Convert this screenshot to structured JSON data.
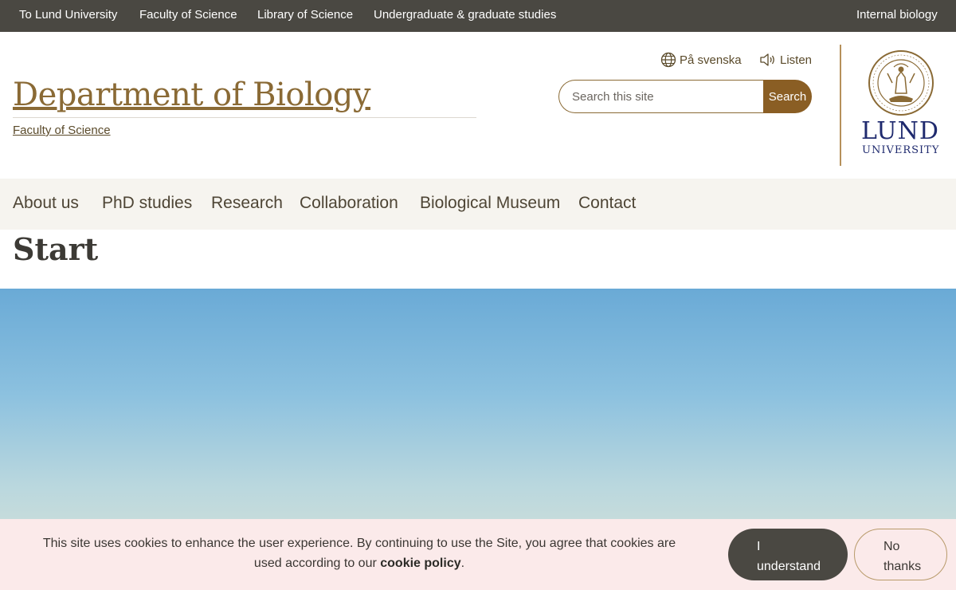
{
  "top_nav": {
    "items": [
      {
        "label": "To Lund University"
      },
      {
        "label": "Faculty of Science"
      },
      {
        "label": "Library of Science"
      },
      {
        "label": "Undergraduate & graduate studies"
      }
    ],
    "right_label": "Internal biology"
  },
  "header": {
    "title": "Department of Biology",
    "subtitle": "Faculty of Science",
    "language_link": "På svenska",
    "listen_link": "Listen",
    "search": {
      "placeholder": "Search this site",
      "value": "",
      "button": "Search"
    },
    "logo": {
      "word1": "LUND",
      "word2": "UNIVERSITY"
    }
  },
  "main_nav": {
    "items": [
      {
        "label": "About us"
      },
      {
        "label": "PhD studies"
      },
      {
        "label": "Research"
      },
      {
        "label": "Collaboration"
      },
      {
        "label": "Biological Museum"
      },
      {
        "label": "Contact"
      }
    ]
  },
  "page": {
    "heading": "Start"
  },
  "cookie": {
    "text_part1": "This site uses cookies to enhance the user experience. By continuing to use the Site, you agree that cookies are used according to our ",
    "policy_link": "cookie policy",
    "text_part2": ".",
    "accept_line1": "I",
    "accept_line2": "understand",
    "decline_line1": "No",
    "decline_line2": "thanks"
  },
  "colors": {
    "brand_bronze": "#8a6a35",
    "topbar_bg": "#4a4842",
    "lund_blue": "#1f2a6e",
    "cookie_bg": "#fbeaea"
  },
  "icons": [
    "globe-icon",
    "speaker-icon",
    "lund-seal-logo"
  ]
}
